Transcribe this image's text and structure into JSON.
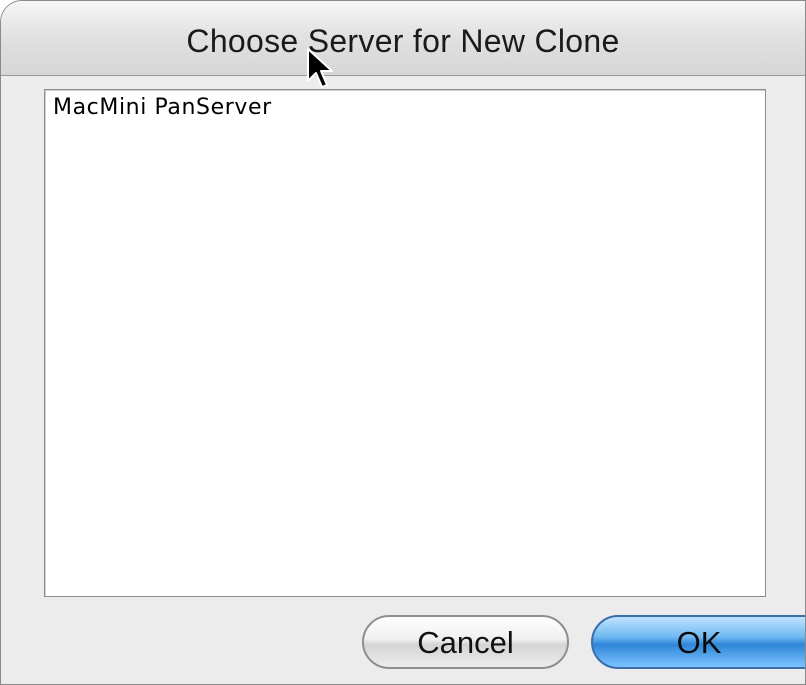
{
  "dialog": {
    "title": "Choose Server for New Clone"
  },
  "server_list": {
    "items": [
      {
        "label": "MacMini PanServer"
      }
    ]
  },
  "buttons": {
    "cancel_label": "Cancel",
    "ok_label": "OK"
  },
  "icons": {
    "cursor": "arrow-cursor-icon"
  },
  "colors": {
    "default_button": "#2f86d8"
  }
}
